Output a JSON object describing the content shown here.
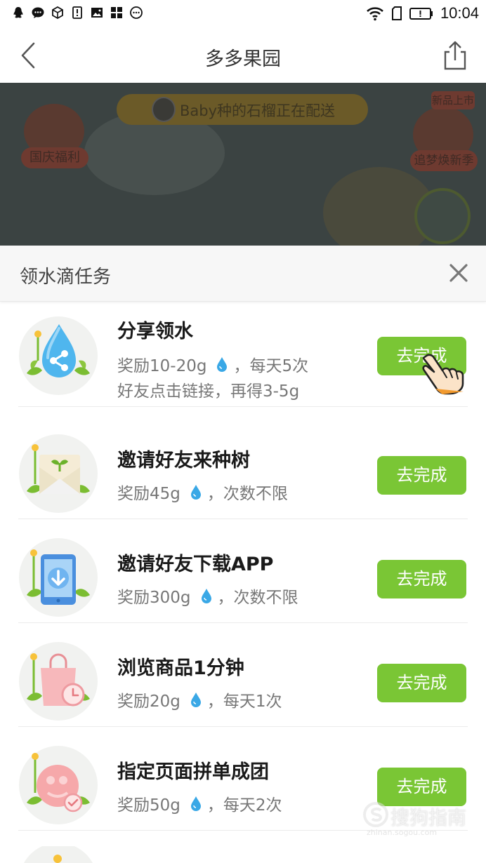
{
  "status_bar": {
    "time": "10:04"
  },
  "nav": {
    "title": "多多果园"
  },
  "game": {
    "banner_text": "Baby种的石榴正在配送",
    "left_label": "国庆福利",
    "right_tag": "新品上市",
    "right_label": "追梦焕新季"
  },
  "sheet": {
    "title": "领水滴任务"
  },
  "tasks": [
    {
      "name": "分享领水",
      "reward_prefix": "奖励10-20g",
      "reward_suffix": "，每天5次",
      "extra": "好友点击链接，再得3-5g",
      "button": "去完成",
      "icon": "share-drop-icon"
    },
    {
      "name": "邀请好友来种树",
      "reward_prefix": "奖励45g",
      "reward_suffix": "，次数不限",
      "button": "去完成",
      "icon": "invite-envelope-icon"
    },
    {
      "name": "邀请好友下载APP",
      "reward_prefix": "奖励300g",
      "reward_suffix": "，次数不限",
      "button": "去完成",
      "icon": "download-phone-icon"
    },
    {
      "name": "浏览商品1分钟",
      "reward_prefix": "奖励20g",
      "reward_suffix": "，每天1次",
      "button": "去完成",
      "icon": "shopping-bag-clock-icon"
    },
    {
      "name": "指定页面拼单成团",
      "reward_prefix": "奖励50g",
      "reward_suffix": "，每天2次",
      "button": "去完成",
      "icon": "group-buy-icon"
    }
  ],
  "watermark": {
    "text": "搜狗指南",
    "sub": "zhinan.sogou.com"
  },
  "colors": {
    "button_green": "#7ac635",
    "drop_blue": "#3aa8e6"
  }
}
